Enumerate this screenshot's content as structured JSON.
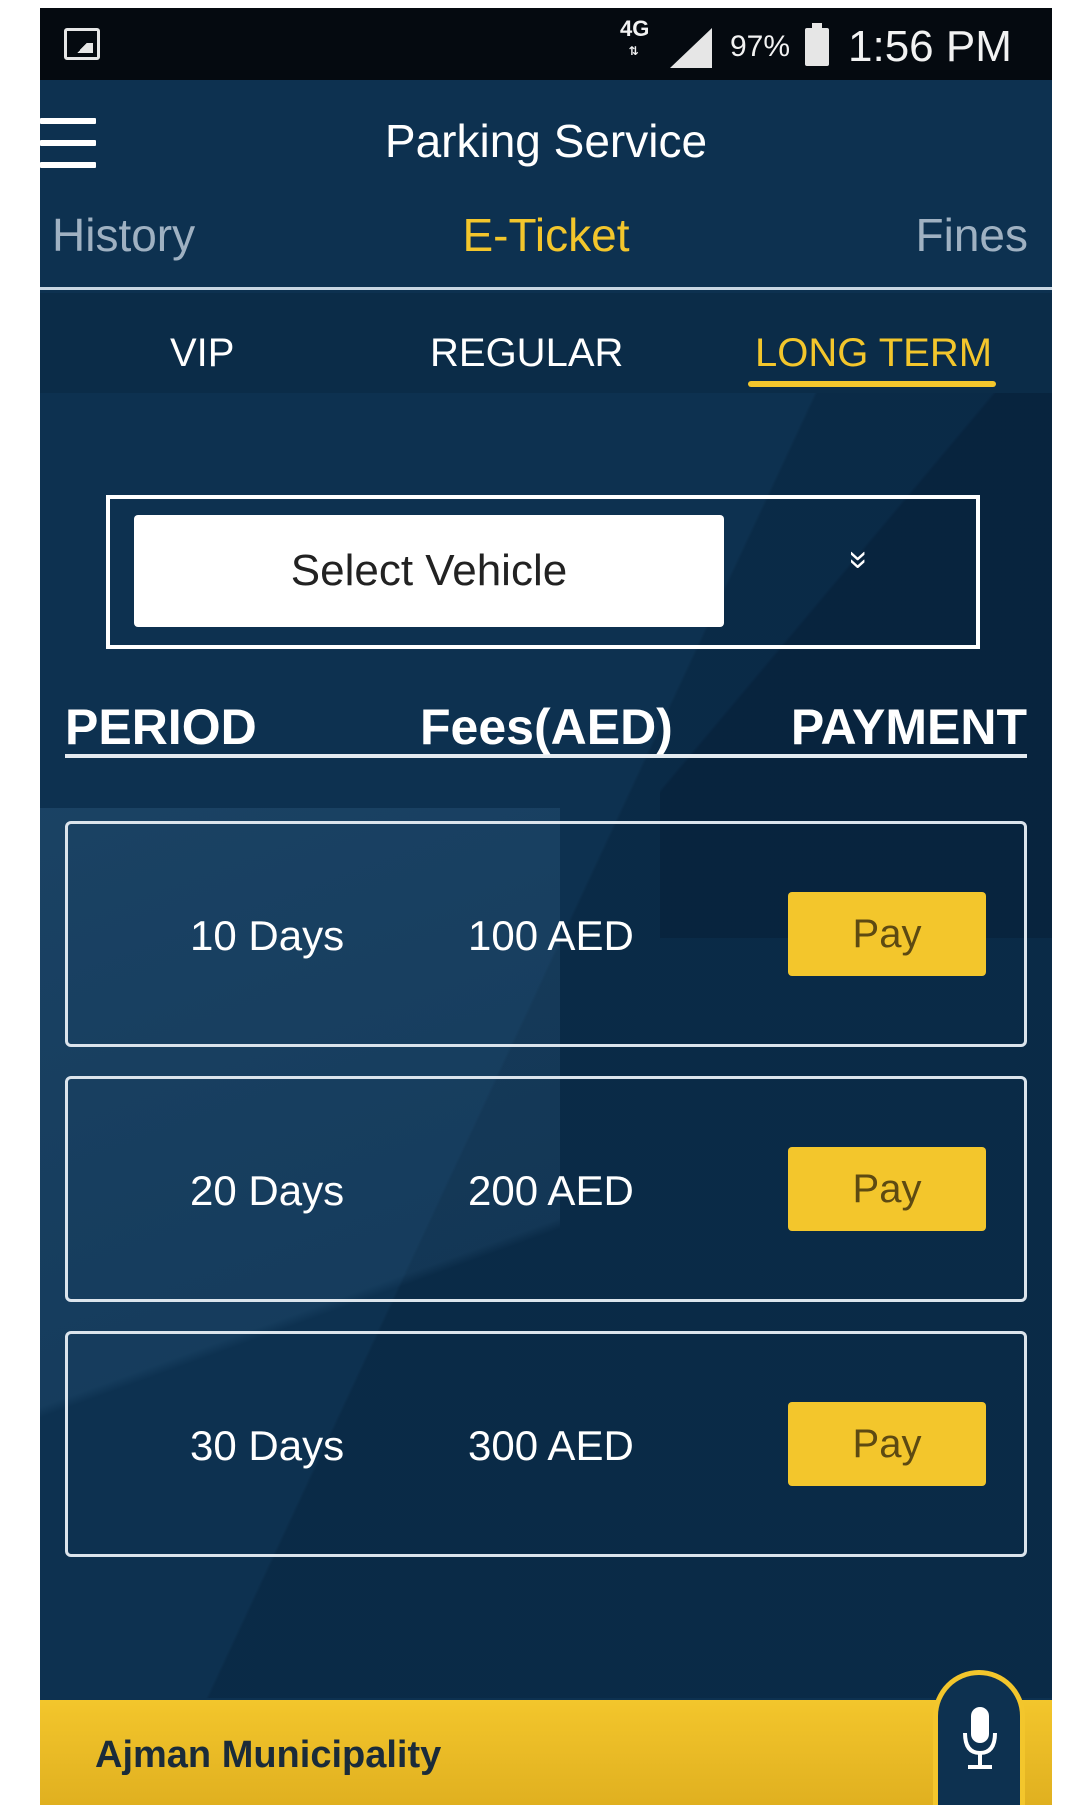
{
  "status_bar": {
    "network": "4G",
    "battery": "97%",
    "time": "1:56 PM"
  },
  "app_bar": {
    "title": "Parking Service"
  },
  "main_tabs": [
    {
      "label": "History"
    },
    {
      "label": "E-Ticket"
    },
    {
      "label": "Fines"
    }
  ],
  "sub_tabs": [
    {
      "label": "VIP"
    },
    {
      "label": "REGULAR"
    },
    {
      "label": "LONG TERM"
    }
  ],
  "vehicle_select": {
    "placeholder": "Select Vehicle",
    "chevron": "»"
  },
  "table": {
    "headers": [
      "PERIOD",
      "Fees(AED)",
      "PAYMENT"
    ],
    "rows": [
      {
        "period": "10 Days",
        "fee": "100 AED",
        "action": "Pay"
      },
      {
        "period": "20 Days",
        "fee": "200 AED",
        "action": "Pay"
      },
      {
        "period": "30 Days",
        "fee": "300 AED",
        "action": "Pay"
      }
    ]
  },
  "footer": {
    "label": "Ajman Municipality"
  },
  "icons": {
    "menu": "hamburger-menu-icon",
    "mic": "microphone-icon",
    "chevron": "double-chevron-down-icon"
  },
  "colors": {
    "background": "#0d3150",
    "accent": "#f3c62c"
  }
}
